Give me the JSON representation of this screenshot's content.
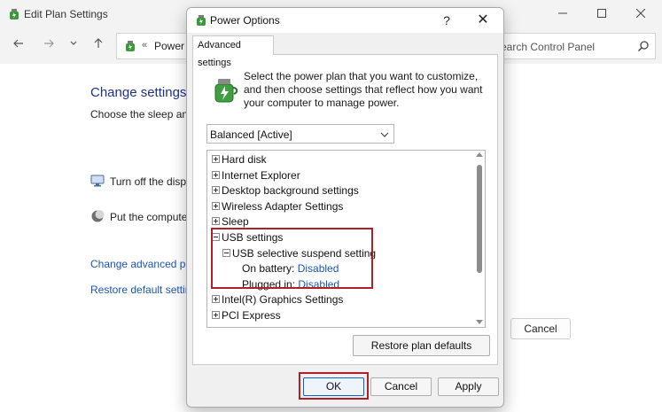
{
  "background_window": {
    "title": "Edit Plan Settings",
    "address": "Power O",
    "address_chevron": "«",
    "search_placeholder": "earch Control Panel",
    "heading": "Change settings",
    "subtitle": "Choose the sleep and",
    "display_label": "Turn off the displ",
    "sleep_label": "Put the computer",
    "link_advanced": "Change advanced pov",
    "link_restore": "Restore default setting",
    "cancel_label": "Cancel"
  },
  "dialog": {
    "title": "Power Options",
    "help_label": "?",
    "close_label": "✕",
    "tab_label": "Advanced settings",
    "description": "Select the power plan that you want to customize, and then choose settings that reflect how you want your computer to manage power.",
    "plan_selected": "Balanced [Active]",
    "tree": [
      {
        "label": "Hard disk",
        "value": "",
        "level": 0,
        "expander": "plus"
      },
      {
        "label": "Internet Explorer",
        "value": "",
        "level": 0,
        "expander": "plus"
      },
      {
        "label": "Desktop background settings",
        "value": "",
        "level": 0,
        "expander": "plus"
      },
      {
        "label": "Wireless Adapter Settings",
        "value": "",
        "level": 0,
        "expander": "plus"
      },
      {
        "label": "Sleep",
        "value": "",
        "level": 0,
        "expander": "plus"
      },
      {
        "label": "USB settings",
        "value": "",
        "level": 0,
        "expander": "minus"
      },
      {
        "label": "USB selective suspend setting",
        "value": "",
        "level": 1,
        "expander": "minus"
      },
      {
        "label": "On battery: ",
        "value": "Disabled",
        "level": 2,
        "expander": "none"
      },
      {
        "label": "Plugged in: ",
        "value": "Disabled",
        "level": 2,
        "expander": "none"
      },
      {
        "label": "Intel(R) Graphics Settings",
        "value": "",
        "level": 0,
        "expander": "plus"
      },
      {
        "label": "PCI Express",
        "value": "",
        "level": 0,
        "expander": "plus"
      }
    ],
    "restore_label": "Restore plan defaults",
    "ok_label": "OK",
    "cancel_label": "Cancel",
    "apply_label": "Apply"
  },
  "colors": {
    "highlight": "#b0202a",
    "link": "#1a56b8",
    "heading": "#1e3287"
  }
}
